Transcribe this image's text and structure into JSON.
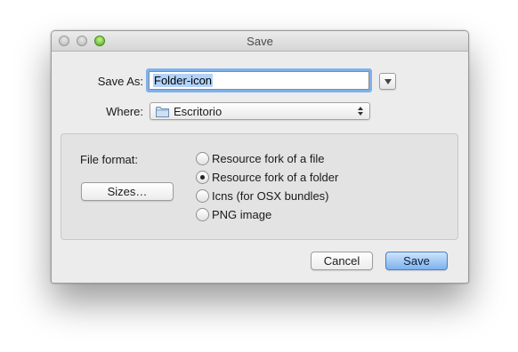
{
  "window": {
    "title": "Save"
  },
  "form": {
    "save_as_label": "Save As:",
    "save_as_value": "Folder-icon",
    "where_label": "Where:",
    "where_value": "Escritorio"
  },
  "options": {
    "file_format_label": "File format:",
    "sizes_button": "Sizes…",
    "formats": [
      {
        "label": "Resource fork of a file",
        "selected": false
      },
      {
        "label": "Resource fork of a folder",
        "selected": true
      },
      {
        "label": "Icns (for OSX bundles)",
        "selected": false
      },
      {
        "label": "PNG image",
        "selected": false
      }
    ]
  },
  "buttons": {
    "cancel": "Cancel",
    "save": "Save"
  },
  "icons": {
    "traffic_lights": [
      "close-icon",
      "minimize-icon",
      "zoom-icon"
    ],
    "disclosure": "chevron-down-icon",
    "folder": "folder-icon",
    "popup_arrows": "updown-arrows-icon"
  },
  "colors": {
    "focus_ring": "#7fb1ea",
    "default_button": "#7cb2ee",
    "zoom_button": "#4fa822"
  }
}
